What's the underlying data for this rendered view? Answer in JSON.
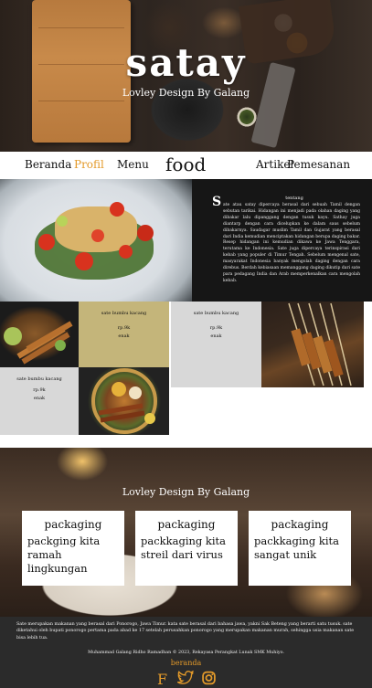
{
  "hero": {
    "title": "satay",
    "subtitle": "Lovley Design By Galang"
  },
  "nav": {
    "items": [
      {
        "label": "Beranda"
      },
      {
        "label": "Profil"
      },
      {
        "label": "Menu"
      },
      {
        "label": "food"
      },
      {
        "label": "Artikel"
      },
      {
        "label": "Pemesanan"
      }
    ]
  },
  "article": {
    "heading": "tentang",
    "dropcap": "S",
    "body": "ate atau satay dipercaya berasal dari sebuah Tamil dengan sebutan tarikai. Hidangan ini menjadi pada olahan daging yang dibakar lalu dipanggang dengan tusuk kayu. Sathay juga diantarp dengan cara dicelupkan ke dalam saus sebelum dibakarnya. Saudagar muslim Tamil dan Gujarat yang berasal dari India kemudian menciptakan hidangan berupa daging bakar. Resep hidangan ini kemudian dikawa ke Jawa Tenggara, terutama ke Indonesia. Sate juga dipercaya terinspirasi dari kebab yang populer di Timur Tengah. Sebelum mengenal sate, masyarakat Indonesia banyak mengolah daging dengan cara direbus. Berdah kebiasaan memanggang daging dikutip dari sate para pedagang India dan Arab memperkenalkan cara mengolah kebab."
  },
  "cards": [
    {
      "title": "sate bumbu kacang",
      "price": "rp.9k",
      "status": "enak"
    },
    {
      "title": "sate bumbu kacang",
      "price": "rp.9k",
      "status": "enak"
    },
    {
      "title": "sate bumbu kacang",
      "price": "rp.9k",
      "status": "enak"
    }
  ],
  "banner": {
    "title": "Lovley Design By Galang",
    "packages": [
      {
        "heading": "packaging",
        "body": "packging kita ramah lingkungan"
      },
      {
        "heading": "packaging",
        "body": "packkaging kita streil dari virus"
      },
      {
        "heading": "packaging",
        "body": "packkaging kita sangat unik"
      }
    ]
  },
  "footer": {
    "description": "Sate merupakan makanan yang berasal dari Ponorogo, Jawa Timur. kata sate berasal dari bahasa jawa, yakni Sak Beteng yang berarti satu tusuk. sate diketahui oleh bupati ponorogo pertama pada abad ke 17 setelah perusahkan ponorogo yang merupakan makanan murah, sehingga usia makanan sate bisa lebih tua.",
    "credit": "Muhammad Galang Ridho Ramadhan © 2023, Rekayasa Perangkat Lunak SMK Muhiyo.",
    "brand": "beranda",
    "social": [
      {
        "icon": "facebook-icon",
        "glyph": "F"
      },
      {
        "icon": "twitter-icon"
      },
      {
        "icon": "instagram-icon"
      }
    ]
  },
  "colors": {
    "accent": "#e39a2a",
    "dark": "#161616",
    "card": "#d8d8d8",
    "card_gold": "#c4b57a",
    "footer": "#2b2b2b"
  }
}
